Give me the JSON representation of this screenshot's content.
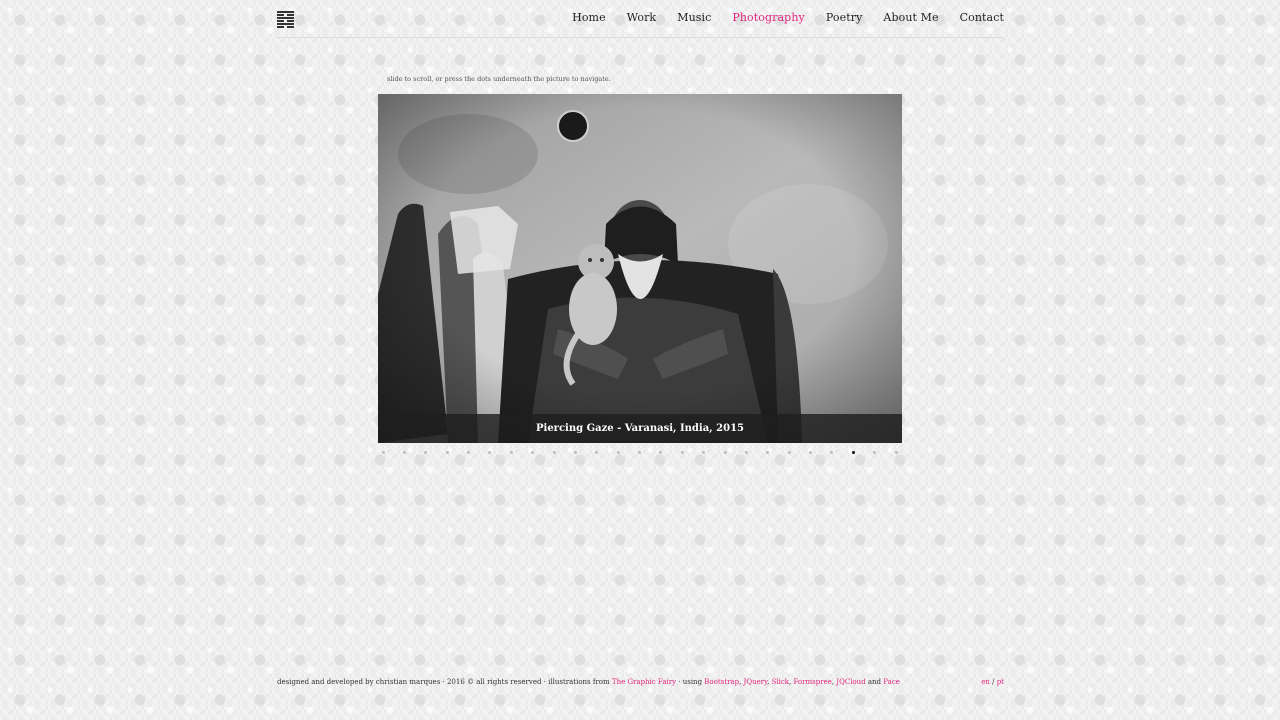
{
  "colors": {
    "accent": "#e0257d",
    "text": "#222222"
  },
  "logo": {
    "icon": "menu-logo-icon"
  },
  "nav": {
    "items": [
      {
        "label": "Home"
      },
      {
        "label": "Work"
      },
      {
        "label": "Music"
      },
      {
        "label": "Photography",
        "active": true
      },
      {
        "label": "Poetry"
      },
      {
        "label": "About Me"
      },
      {
        "label": "Contact"
      }
    ]
  },
  "slider": {
    "hint": "slide to scroll, or press the dots underneath the picture to navigate.",
    "caption": "Piercing Gaze - Varanasi, India, 2015",
    "dot_count": 25,
    "active_dot": 22
  },
  "footer": {
    "credit_prefix": "designed and developed by christian marques · 2016 © all rights reserved · illustrations from",
    "illustrations_link": "The Graphic Fairy",
    "using_text": "· using",
    "links": [
      "Bootstrap",
      "JQuery",
      "Slick",
      "Formspree",
      "JQCloud"
    ],
    "and_text": "and",
    "last_link": "Pace",
    "lang_en": "en",
    "lang_sep": "/",
    "lang_pt": "pt"
  }
}
